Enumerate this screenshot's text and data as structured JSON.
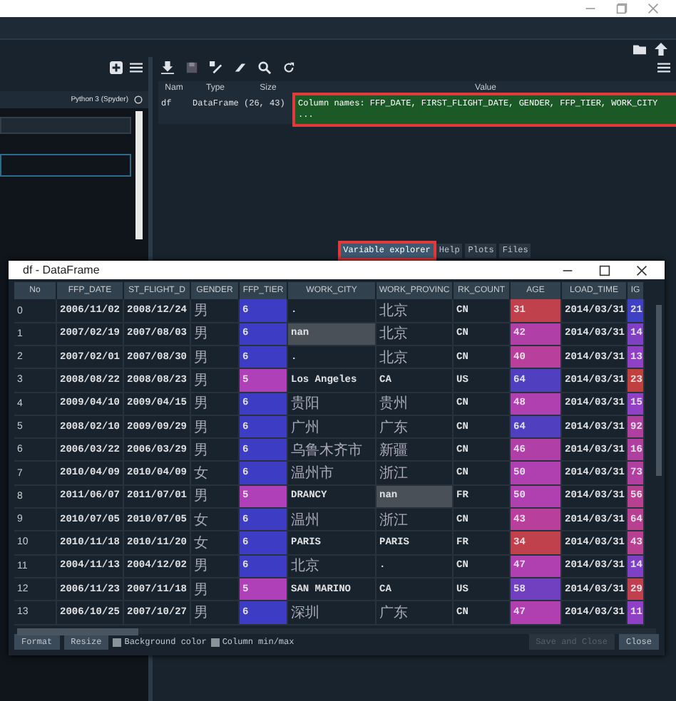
{
  "console": {
    "tab": "Python 3 (Spyder)"
  },
  "variable_explorer": {
    "columns": [
      "Nam",
      "Type",
      "Size",
      "Value"
    ],
    "rows": [
      {
        "name": "df",
        "type": "DataFrame",
        "size": "(26, 43)",
        "value": "Column names: FFP_DATE, FIRST_FLIGHT_DATE, GENDER, FFP_TIER, WORK_CITY ...",
        "highlighted": true
      }
    ]
  },
  "pane_tabs": [
    {
      "label": "Variable explorer",
      "selected": true,
      "highlighted": true
    },
    {
      "label": "Help",
      "selected": false,
      "highlighted": false
    },
    {
      "label": "Plots",
      "selected": false,
      "highlighted": false
    },
    {
      "label": "Files",
      "selected": false,
      "highlighted": false
    }
  ],
  "dataframe_window": {
    "title": "df - DataFrame",
    "columns": [
      "No",
      "FFP_DATE",
      "ST_FLIGHT_D",
      "GENDER",
      "FFP_TIER",
      "WORK_CITY",
      "WORK_PROVINC",
      "RK_COUNT",
      "AGE",
      "LOAD_TIME",
      "IG"
    ],
    "rows": [
      {
        "cells": [
          {
            "text": "0"
          },
          {
            "text": "2006/11/02"
          },
          {
            "text": "2008/12/24"
          },
          {
            "text": "男"
          },
          {
            "text": "6",
            "color": "#3c3cc4"
          },
          {
            "text": "."
          },
          {
            "text": "北京"
          },
          {
            "text": "CN"
          },
          {
            "text": "31",
            "color": "#c0404c"
          },
          {
            "text": "2014/03/31"
          },
          {
            "text": "21",
            "color": "#4040c4"
          }
        ]
      },
      {
        "cells": [
          {
            "text": "1"
          },
          {
            "text": "2007/02/19"
          },
          {
            "text": "2007/08/03"
          },
          {
            "text": "男"
          },
          {
            "text": "6",
            "color": "#3c3cc4"
          },
          {
            "text": "nan",
            "color": "#4a5058"
          },
          {
            "text": "北京"
          },
          {
            "text": "CN"
          },
          {
            "text": "42",
            "color": "#b040a8"
          },
          {
            "text": "2014/03/31"
          },
          {
            "text": "14",
            "color": "#8040c4"
          }
        ]
      },
      {
        "cells": [
          {
            "text": "2"
          },
          {
            "text": "2007/02/01"
          },
          {
            "text": "2007/08/30"
          },
          {
            "text": "男"
          },
          {
            "text": "6",
            "color": "#3c3cc4"
          },
          {
            "text": "."
          },
          {
            "text": "北京"
          },
          {
            "text": "CN"
          },
          {
            "text": "40",
            "color": "#b8409c"
          },
          {
            "text": "2014/03/31"
          },
          {
            "text": "13",
            "color": "#9040c4"
          }
        ]
      },
      {
        "cells": [
          {
            "text": "3"
          },
          {
            "text": "2008/08/22"
          },
          {
            "text": "2008/08/23"
          },
          {
            "text": "男"
          },
          {
            "text": "5",
            "color": "#b040b8"
          },
          {
            "text": "Los Angeles"
          },
          {
            "text": "CA"
          },
          {
            "text": "US"
          },
          {
            "text": "64",
            "color": "#5040c0"
          },
          {
            "text": "2014/03/31"
          },
          {
            "text": "23",
            "color": "#c04040"
          }
        ]
      },
      {
        "cells": [
          {
            "text": "4"
          },
          {
            "text": "2009/04/10"
          },
          {
            "text": "2009/04/15"
          },
          {
            "text": "男"
          },
          {
            "text": "6",
            "color": "#3c3cc4"
          },
          {
            "text": "贵阳"
          },
          {
            "text": "贵州"
          },
          {
            "text": "CN"
          },
          {
            "text": "48",
            "color": "#b040b0"
          },
          {
            "text": "2014/03/31"
          },
          {
            "text": "15",
            "color": "#9040c4"
          }
        ]
      },
      {
        "cells": [
          {
            "text": "5"
          },
          {
            "text": "2008/02/10"
          },
          {
            "text": "2009/09/29"
          },
          {
            "text": "男"
          },
          {
            "text": "6",
            "color": "#3c3cc4"
          },
          {
            "text": "广州"
          },
          {
            "text": "广东"
          },
          {
            "text": "CN"
          },
          {
            "text": "64",
            "color": "#5040c0"
          },
          {
            "text": "2014/03/31"
          },
          {
            "text": "92",
            "color": "#b040a0"
          }
        ]
      },
      {
        "cells": [
          {
            "text": "6"
          },
          {
            "text": "2006/03/22"
          },
          {
            "text": "2006/03/29"
          },
          {
            "text": "男"
          },
          {
            "text": "6",
            "color": "#3c3cc4"
          },
          {
            "text": "乌鲁木齐市"
          },
          {
            "text": "新疆"
          },
          {
            "text": "CN"
          },
          {
            "text": "46",
            "color": "#b040a8"
          },
          {
            "text": "2014/03/31"
          },
          {
            "text": "16",
            "color": "#b040a0"
          }
        ]
      },
      {
        "cells": [
          {
            "text": "7"
          },
          {
            "text": "2010/04/09"
          },
          {
            "text": "2010/04/09"
          },
          {
            "text": "女"
          },
          {
            "text": "6",
            "color": "#3c3cc4"
          },
          {
            "text": "温州市"
          },
          {
            "text": "浙江"
          },
          {
            "text": "CN"
          },
          {
            "text": "50",
            "color": "#b040b0"
          },
          {
            "text": "2014/03/31"
          },
          {
            "text": "73",
            "color": "#b040a0"
          }
        ]
      },
      {
        "cells": [
          {
            "text": "8"
          },
          {
            "text": "2011/06/07"
          },
          {
            "text": "2011/07/01"
          },
          {
            "text": "男"
          },
          {
            "text": "5",
            "color": "#b040b8"
          },
          {
            "text": "DRANCY"
          },
          {
            "text": "nan",
            "color": "#4a5058"
          },
          {
            "text": "FR"
          },
          {
            "text": "50",
            "color": "#b040b0"
          },
          {
            "text": "2014/03/31"
          },
          {
            "text": "56",
            "color": "#b84090"
          }
        ]
      },
      {
        "cells": [
          {
            "text": "9"
          },
          {
            "text": "2010/07/05"
          },
          {
            "text": "2010/07/05"
          },
          {
            "text": "女"
          },
          {
            "text": "6",
            "color": "#3c3cc4"
          },
          {
            "text": "温州"
          },
          {
            "text": "浙江"
          },
          {
            "text": "CN"
          },
          {
            "text": "43",
            "color": "#b8409c"
          },
          {
            "text": "2014/03/31"
          },
          {
            "text": "64",
            "color": "#b84090"
          }
        ]
      },
      {
        "cells": [
          {
            "text": "10"
          },
          {
            "text": "2010/11/18"
          },
          {
            "text": "2010/11/20"
          },
          {
            "text": "女"
          },
          {
            "text": "6",
            "color": "#3c3cc4"
          },
          {
            "text": "PARIS"
          },
          {
            "text": "PARIS"
          },
          {
            "text": "FR"
          },
          {
            "text": "34",
            "color": "#c0404c"
          },
          {
            "text": "2014/03/31"
          },
          {
            "text": "43",
            "color": "#b84090"
          }
        ]
      },
      {
        "cells": [
          {
            "text": "11"
          },
          {
            "text": "2004/11/13"
          },
          {
            "text": "2004/12/02"
          },
          {
            "text": "男"
          },
          {
            "text": "6",
            "color": "#3c3cc4"
          },
          {
            "text": "北京"
          },
          {
            "text": "."
          },
          {
            "text": "CN"
          },
          {
            "text": "47",
            "color": "#b040b0"
          },
          {
            "text": "2014/03/31"
          },
          {
            "text": "14",
            "color": "#8040c4"
          }
        ]
      },
      {
        "cells": [
          {
            "text": "12"
          },
          {
            "text": "2006/11/23"
          },
          {
            "text": "2007/11/18"
          },
          {
            "text": "男"
          },
          {
            "text": "5",
            "color": "#b040b8"
          },
          {
            "text": "SAN MARINO"
          },
          {
            "text": "CA"
          },
          {
            "text": "US"
          },
          {
            "text": "58",
            "color": "#7040c0"
          },
          {
            "text": "2014/03/31"
          },
          {
            "text": "29",
            "color": "#c04050"
          }
        ]
      },
      {
        "cells": [
          {
            "text": "13"
          },
          {
            "text": "2006/10/25"
          },
          {
            "text": "2007/10/27"
          },
          {
            "text": "男"
          },
          {
            "text": "6",
            "color": "#3c3cc4"
          },
          {
            "text": "深圳"
          },
          {
            "text": "广东"
          },
          {
            "text": "CN"
          },
          {
            "text": "47",
            "color": "#b040b0"
          },
          {
            "text": "2014/03/31"
          },
          {
            "text": "11",
            "color": "#9040c4"
          }
        ]
      }
    ],
    "footer_buttons": [
      {
        "label": "Format",
        "disabled": false
      },
      {
        "label": "Resize",
        "disabled": false
      }
    ],
    "checkboxes": [
      {
        "label": "Background color",
        "checked": true
      },
      {
        "label": "Column min/max",
        "checked": true
      }
    ],
    "dialog_buttons": [
      {
        "label": "Save and Close",
        "disabled": true
      },
      {
        "label": "Close",
        "disabled": false
      }
    ]
  }
}
